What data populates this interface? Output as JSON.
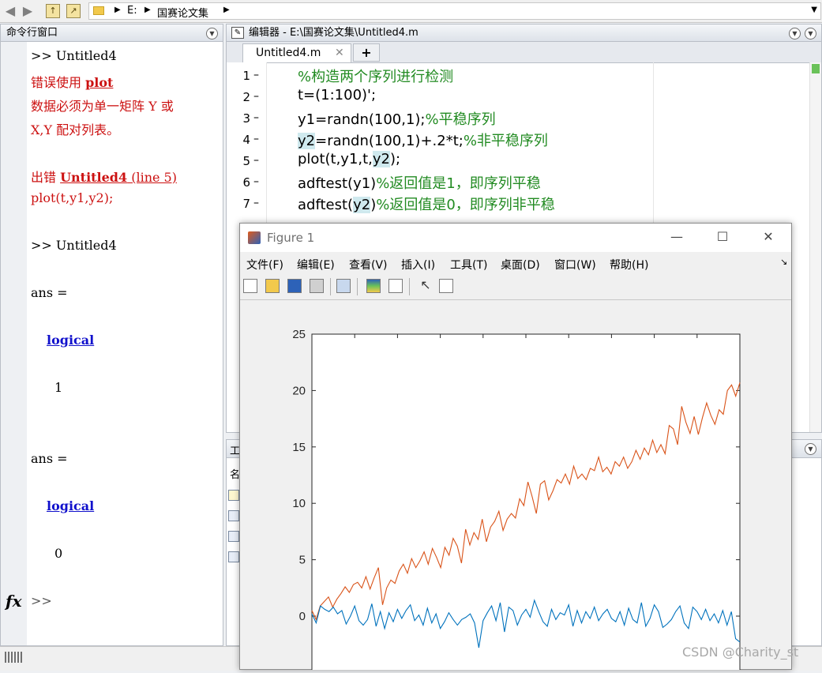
{
  "address_bar": {
    "path": [
      "E:",
      "国赛论文集"
    ]
  },
  "command_window": {
    "title": "命令行窗口",
    "lines": {
      "l1": ">> Untitled4",
      "l2_prefix": "错误使用 ",
      "l2_link": "plot",
      "l3": "数据必须为单一矩阵 Y 或",
      "l4": "X,Y 配对列表。",
      "l5_prefix": "出错 ",
      "l5_link": "Untitled4",
      "l5_suffix": " (line 5)",
      "l6": "plot(t,y1,y2);",
      "l7": ">> Untitled4",
      "l8": "ans =",
      "l9": "logical",
      "l10": "1",
      "l11": "ans =",
      "l12": "logical",
      "l13": "0"
    },
    "fx": "fx",
    "prompt": ">>"
  },
  "editor": {
    "title": "编辑器 - E:\\国赛论文集\\Untitled4.m",
    "tab": "Untitled4.m",
    "add_tab": "+",
    "code": [
      {
        "num": "1",
        "parts": [
          {
            "t": "%构造两个序列进行检测",
            "c": "cm"
          }
        ]
      },
      {
        "num": "2",
        "parts": [
          {
            "t": "t=(1:100)';",
            "c": ""
          }
        ]
      },
      {
        "num": "3",
        "parts": [
          {
            "t": "y1=randn(100,1);",
            "c": ""
          },
          {
            "t": "%平稳序列",
            "c": "cm"
          }
        ]
      },
      {
        "num": "4",
        "parts": [
          {
            "t": "y2",
            "c": "hl"
          },
          {
            "t": "=randn(100,1)+.2*t;",
            "c": ""
          },
          {
            "t": "%非平稳序列",
            "c": "cm"
          }
        ]
      },
      {
        "num": "5",
        "parts": [
          {
            "t": "plot(t,y1,t,",
            "c": ""
          },
          {
            "t": "y2",
            "c": "hl"
          },
          {
            "t": ");",
            "c": ""
          }
        ]
      },
      {
        "num": "6",
        "parts": [
          {
            "t": "adftest(y1)",
            "c": ""
          },
          {
            "t": "%返回值是1，即序列平稳",
            "c": "cm"
          }
        ]
      },
      {
        "num": "7",
        "parts": [
          {
            "t": "adftest(",
            "c": ""
          },
          {
            "t": "y2",
            "c": "hl"
          },
          {
            "t": ")",
            "c": ""
          },
          {
            "t": "%返回值是0，即序列非平稳",
            "c": "cm"
          }
        ]
      }
    ]
  },
  "workspace": {
    "head_char": "工",
    "col_char": "名"
  },
  "figure": {
    "title": "Figure 1",
    "menu": [
      "文件(F)",
      "编辑(E)",
      "查看(V)",
      "插入(I)",
      "工具(T)",
      "桌面(D)",
      "窗口(W)",
      "帮助(H)"
    ],
    "min_label": "—",
    "max_label": "☐",
    "close_label": "✕"
  },
  "chart_data": {
    "type": "line",
    "ylim": [
      -3,
      25
    ],
    "xlim": [
      0,
      100
    ],
    "yticks": [
      "0",
      "5",
      "10",
      "15",
      "20",
      "25"
    ],
    "ytick_values": [
      0,
      5,
      10,
      15,
      20,
      25
    ],
    "series": [
      {
        "color": "#D95319",
        "values": [
          0.5,
          -0.3,
          0.9,
          1.3,
          1.7,
          0.8,
          1.5,
          2.0,
          2.6,
          2.1,
          2.8,
          3.0,
          2.5,
          3.5,
          2.4,
          3.4,
          4.3,
          1.0,
          2.5,
          3.2,
          2.9,
          4.0,
          4.6,
          3.8,
          5.1,
          4.3,
          4.9,
          5.7,
          4.6,
          6.0,
          5.2,
          4.3,
          6.1,
          5.4,
          6.9,
          6.2,
          4.7,
          7.7,
          6.3,
          7.4,
          6.8,
          8.6,
          6.6,
          7.9,
          8.4,
          9.3,
          7.6,
          8.6,
          9.1,
          8.7,
          10.4,
          9.8,
          11.9,
          10.6,
          9.1,
          11.7,
          12.0,
          10.3,
          11.1,
          12.1,
          11.8,
          12.6,
          11.7,
          13.3,
          12.2,
          12.6,
          12.1,
          13.1,
          12.9,
          14.1,
          12.8,
          13.2,
          12.6,
          13.7,
          13.3,
          14.1,
          13.1,
          13.7,
          14.7,
          13.9,
          14.9,
          14.3,
          15.6,
          14.5,
          15.2,
          14.4,
          16.9,
          16.6,
          15.2,
          18.6,
          17.2,
          16.2,
          17.7,
          16.1,
          17.6,
          18.9,
          17.8,
          17.0,
          18.3,
          17.9,
          20.0,
          20.5,
          19.5,
          20.7
        ]
      },
      {
        "color": "#0072BD",
        "values": [
          0.2,
          -0.6,
          0.9,
          0.6,
          0.4,
          0.8,
          0.2,
          0.5,
          -0.7,
          0.0,
          0.9,
          -0.4,
          -0.8,
          -0.3,
          1.1,
          -0.9,
          0.4,
          -1.1,
          0.3,
          -0.5,
          0.6,
          -0.2,
          0.5,
          1.0,
          -0.4,
          0.1,
          -0.8,
          0.7,
          -0.6,
          0.2,
          -1.1,
          -0.5,
          0.3,
          -0.3,
          -0.8,
          -0.3,
          -0.1,
          0.2,
          -0.6,
          -2.8,
          -0.4,
          0.3,
          0.9,
          -0.4,
          1.2,
          -1.4,
          0.8,
          0.5,
          -0.8,
          0.1,
          0.6,
          -0.1,
          1.4,
          0.4,
          -0.5,
          -0.9,
          0.6,
          -0.3,
          0.3,
          0.1,
          1.0,
          -0.9,
          0.5,
          -0.6,
          0.4,
          -0.2,
          0.8,
          -0.4,
          0.2,
          0.6,
          -0.2,
          -0.5,
          0.4,
          -0.8,
          0.7,
          -0.3,
          -0.6,
          1.2,
          -0.9,
          -0.2,
          1.0,
          0.4,
          -1.0,
          -0.7,
          -0.3,
          0.4,
          0.9,
          -0.6,
          -1.1,
          0.8,
          0.4,
          -0.3,
          0.6,
          -0.4,
          0.2,
          -0.6,
          0.5,
          -0.8,
          0.4,
          -2.0,
          -2.3
        ]
      }
    ]
  },
  "watermark": "CSDN @Charity_st"
}
